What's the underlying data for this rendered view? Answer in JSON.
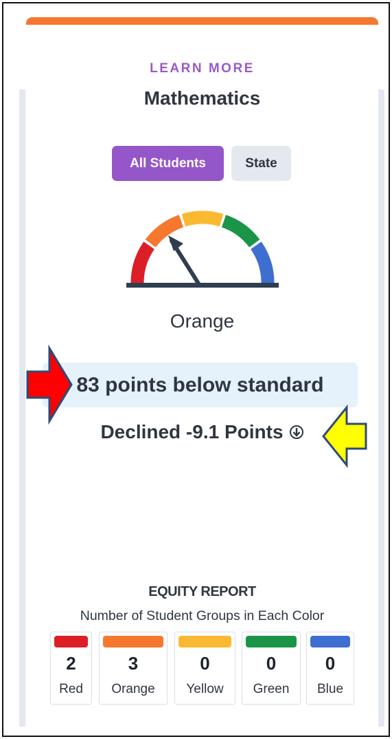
{
  "header": {
    "eyebrow": "LEARN MORE",
    "title": "Mathematics"
  },
  "tabs": [
    {
      "label": "All Students",
      "active": true
    },
    {
      "label": "State",
      "active": false
    }
  ],
  "gauge": {
    "segments": [
      "#dc1f26",
      "#f6772e",
      "#fbb932",
      "#1a9547",
      "#3e6fd0"
    ],
    "needle_color": "#2f3e50",
    "base_color": "#2f3e50",
    "needle_position": "orange",
    "status": "Orange"
  },
  "performance": {
    "distance_from_standard": "83 points below standard",
    "change": "Declined -9.1 Points",
    "change_icon": "circle-arrow-down-icon"
  },
  "annotations": {
    "red_arrow": {
      "fill": "#ff0000",
      "stroke": "#2e4a7a"
    },
    "yellow_arrow": {
      "fill": "#ffff00",
      "stroke": "#2e4a7a"
    }
  },
  "equity": {
    "title": "EQUITY REPORT",
    "subtitle": "Number of Student Groups in Each Color",
    "colors": [
      {
        "name": "Red",
        "count": "2",
        "swatch": "#dc1f26"
      },
      {
        "name": "Orange",
        "count": "3",
        "swatch": "#f6772e"
      },
      {
        "name": "Yellow",
        "count": "0",
        "swatch": "#fbb932"
      },
      {
        "name": "Green",
        "count": "0",
        "swatch": "#1a9547"
      },
      {
        "name": "Blue",
        "count": "0",
        "swatch": "#3e6fd0"
      }
    ]
  },
  "theme": {
    "accent": "#f6772e",
    "purple": "#9556c9",
    "text": "#2f3640",
    "highlight_bg": "#e5f1fb"
  }
}
